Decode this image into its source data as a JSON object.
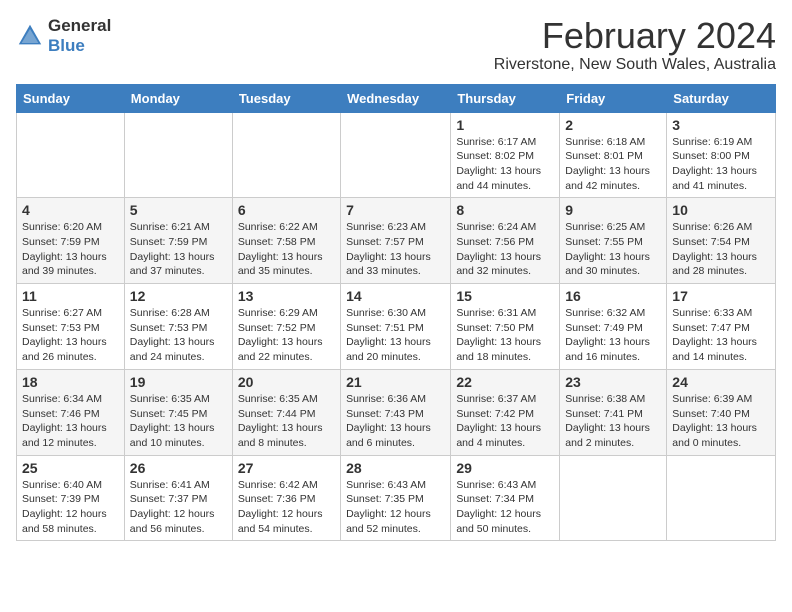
{
  "header": {
    "logo_general": "General",
    "logo_blue": "Blue",
    "month_year": "February 2024",
    "location": "Riverstone, New South Wales, Australia"
  },
  "days_of_week": [
    "Sunday",
    "Monday",
    "Tuesday",
    "Wednesday",
    "Thursday",
    "Friday",
    "Saturday"
  ],
  "weeks": [
    [
      {
        "day": "",
        "info": ""
      },
      {
        "day": "",
        "info": ""
      },
      {
        "day": "",
        "info": ""
      },
      {
        "day": "",
        "info": ""
      },
      {
        "day": "1",
        "info": "Sunrise: 6:17 AM\nSunset: 8:02 PM\nDaylight: 13 hours and 44 minutes."
      },
      {
        "day": "2",
        "info": "Sunrise: 6:18 AM\nSunset: 8:01 PM\nDaylight: 13 hours and 42 minutes."
      },
      {
        "day": "3",
        "info": "Sunrise: 6:19 AM\nSunset: 8:00 PM\nDaylight: 13 hours and 41 minutes."
      }
    ],
    [
      {
        "day": "4",
        "info": "Sunrise: 6:20 AM\nSunset: 7:59 PM\nDaylight: 13 hours and 39 minutes."
      },
      {
        "day": "5",
        "info": "Sunrise: 6:21 AM\nSunset: 7:59 PM\nDaylight: 13 hours and 37 minutes."
      },
      {
        "day": "6",
        "info": "Sunrise: 6:22 AM\nSunset: 7:58 PM\nDaylight: 13 hours and 35 minutes."
      },
      {
        "day": "7",
        "info": "Sunrise: 6:23 AM\nSunset: 7:57 PM\nDaylight: 13 hours and 33 minutes."
      },
      {
        "day": "8",
        "info": "Sunrise: 6:24 AM\nSunset: 7:56 PM\nDaylight: 13 hours and 32 minutes."
      },
      {
        "day": "9",
        "info": "Sunrise: 6:25 AM\nSunset: 7:55 PM\nDaylight: 13 hours and 30 minutes."
      },
      {
        "day": "10",
        "info": "Sunrise: 6:26 AM\nSunset: 7:54 PM\nDaylight: 13 hours and 28 minutes."
      }
    ],
    [
      {
        "day": "11",
        "info": "Sunrise: 6:27 AM\nSunset: 7:53 PM\nDaylight: 13 hours and 26 minutes."
      },
      {
        "day": "12",
        "info": "Sunrise: 6:28 AM\nSunset: 7:53 PM\nDaylight: 13 hours and 24 minutes."
      },
      {
        "day": "13",
        "info": "Sunrise: 6:29 AM\nSunset: 7:52 PM\nDaylight: 13 hours and 22 minutes."
      },
      {
        "day": "14",
        "info": "Sunrise: 6:30 AM\nSunset: 7:51 PM\nDaylight: 13 hours and 20 minutes."
      },
      {
        "day": "15",
        "info": "Sunrise: 6:31 AM\nSunset: 7:50 PM\nDaylight: 13 hours and 18 minutes."
      },
      {
        "day": "16",
        "info": "Sunrise: 6:32 AM\nSunset: 7:49 PM\nDaylight: 13 hours and 16 minutes."
      },
      {
        "day": "17",
        "info": "Sunrise: 6:33 AM\nSunset: 7:47 PM\nDaylight: 13 hours and 14 minutes."
      }
    ],
    [
      {
        "day": "18",
        "info": "Sunrise: 6:34 AM\nSunset: 7:46 PM\nDaylight: 13 hours and 12 minutes."
      },
      {
        "day": "19",
        "info": "Sunrise: 6:35 AM\nSunset: 7:45 PM\nDaylight: 13 hours and 10 minutes."
      },
      {
        "day": "20",
        "info": "Sunrise: 6:35 AM\nSunset: 7:44 PM\nDaylight: 13 hours and 8 minutes."
      },
      {
        "day": "21",
        "info": "Sunrise: 6:36 AM\nSunset: 7:43 PM\nDaylight: 13 hours and 6 minutes."
      },
      {
        "day": "22",
        "info": "Sunrise: 6:37 AM\nSunset: 7:42 PM\nDaylight: 13 hours and 4 minutes."
      },
      {
        "day": "23",
        "info": "Sunrise: 6:38 AM\nSunset: 7:41 PM\nDaylight: 13 hours and 2 minutes."
      },
      {
        "day": "24",
        "info": "Sunrise: 6:39 AM\nSunset: 7:40 PM\nDaylight: 13 hours and 0 minutes."
      }
    ],
    [
      {
        "day": "25",
        "info": "Sunrise: 6:40 AM\nSunset: 7:39 PM\nDaylight: 12 hours and 58 minutes."
      },
      {
        "day": "26",
        "info": "Sunrise: 6:41 AM\nSunset: 7:37 PM\nDaylight: 12 hours and 56 minutes."
      },
      {
        "day": "27",
        "info": "Sunrise: 6:42 AM\nSunset: 7:36 PM\nDaylight: 12 hours and 54 minutes."
      },
      {
        "day": "28",
        "info": "Sunrise: 6:43 AM\nSunset: 7:35 PM\nDaylight: 12 hours and 52 minutes."
      },
      {
        "day": "29",
        "info": "Sunrise: 6:43 AM\nSunset: 7:34 PM\nDaylight: 12 hours and 50 minutes."
      },
      {
        "day": "",
        "info": ""
      },
      {
        "day": "",
        "info": ""
      }
    ]
  ]
}
